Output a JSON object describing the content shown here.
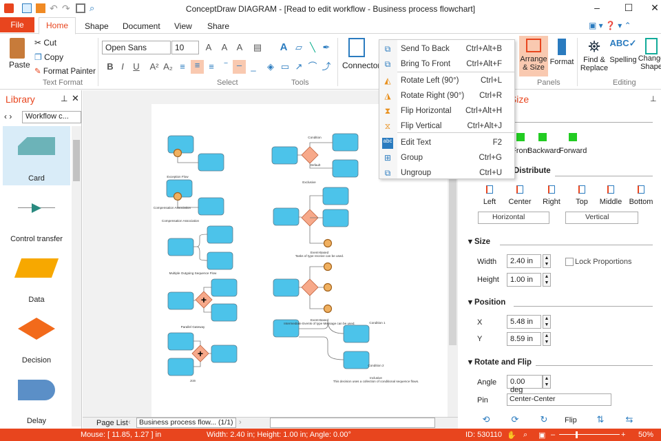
{
  "app": {
    "title": "ConceptDraw DIAGRAM - [Read to edit workflow - Business process flowchart]"
  },
  "tabs": {
    "file": "File",
    "items": [
      "Home",
      "Shape",
      "Document",
      "View",
      "Share"
    ]
  },
  "ribbon": {
    "paste": "Paste",
    "cut": "Cut",
    "copy": "Copy",
    "format_painter": "Format Painter",
    "font": "Open Sans",
    "font_size": "10",
    "connector": "Connector",
    "arrange_size": "Arrange & Size",
    "format": "Format",
    "find_replace": "Find & Replace",
    "spelling": "Spelling",
    "change_shape": "Change Shape",
    "groups": {
      "text_format": "Text Format",
      "select": "Select",
      "tools": "Tools",
      "panels": "Panels",
      "editing": "Editing"
    }
  },
  "context_menu": [
    {
      "label": "Send To Back",
      "shortcut": "Ctrl+Alt+B"
    },
    {
      "label": "Bring To Front",
      "shortcut": "Ctrl+Alt+F"
    },
    {
      "label": "Rotate Left (90°)",
      "shortcut": "Ctrl+L"
    },
    {
      "label": "Rotate Right (90°)",
      "shortcut": "Ctrl+R"
    },
    {
      "label": "Flip Horizontal",
      "shortcut": "Ctrl+Alt+H"
    },
    {
      "label": "Flip Vertical",
      "shortcut": "Ctrl+Alt+J"
    },
    {
      "label": "Edit Text",
      "shortcut": "F2"
    },
    {
      "label": "Group",
      "shortcut": "Ctrl+G"
    },
    {
      "label": "Ungroup",
      "shortcut": "Ctrl+U"
    }
  ],
  "library": {
    "title": "Library",
    "selector": "Workflow c...",
    "items": [
      "Card",
      "Control transfer",
      "Data",
      "Decision",
      "Delay"
    ]
  },
  "diagram": {
    "labels": [
      "Exception Flow",
      "Compensation Association",
      "Compensation Association",
      "Multiple Outgoing Sequence Flow",
      "Parallel Gateway",
      "Join",
      "Condition",
      "Default",
      "Exclusive",
      "Event-Based",
      "Tasks of type receive can be used.",
      "Event-Based",
      "Intermediate Events of type Message can be used.",
      "Condition 1",
      "Condition 2",
      "Inclusive",
      "This decision uses a collection of conditional sequence flows."
    ]
  },
  "page_bar": {
    "page_list": "Page List",
    "page": "Business process flow... (1/1)"
  },
  "panel": {
    "title": "Arrange & Size",
    "order_buttons": [
      "Front",
      "Backward",
      "Forward"
    ],
    "align_section": "Distribute",
    "align_buttons": [
      "Left",
      "Center",
      "Right",
      "Top",
      "Middle",
      "Bottom"
    ],
    "distribute_h": "Horizontal",
    "distribute_v": "Vertical",
    "size_section": "Size",
    "width_label": "Width",
    "width": "2.40 in",
    "height_label": "Height",
    "height": "1.00 in",
    "lock": "Lock Proportions",
    "position_section": "Position",
    "x_label": "X",
    "x": "5.48 in",
    "y_label": "Y",
    "y": "8.59 in",
    "rotate_section": "Rotate and Flip",
    "angle_label": "Angle",
    "angle": "0.00 deg",
    "pin_label": "Pin",
    "pin": "Center-Center",
    "flip": "Flip"
  },
  "status": {
    "mouse": "Mouse: [ 11.85, 1.27 ] in",
    "dims": "Width: 2.40 in;  Height: 1.00 in;  Angle: 0.00°",
    "id": "ID: 530110",
    "zoom": "50%"
  },
  "colors": {
    "accent": "#e8451e",
    "shape": "#4cc3ea",
    "gateway": "#f7a98a"
  }
}
